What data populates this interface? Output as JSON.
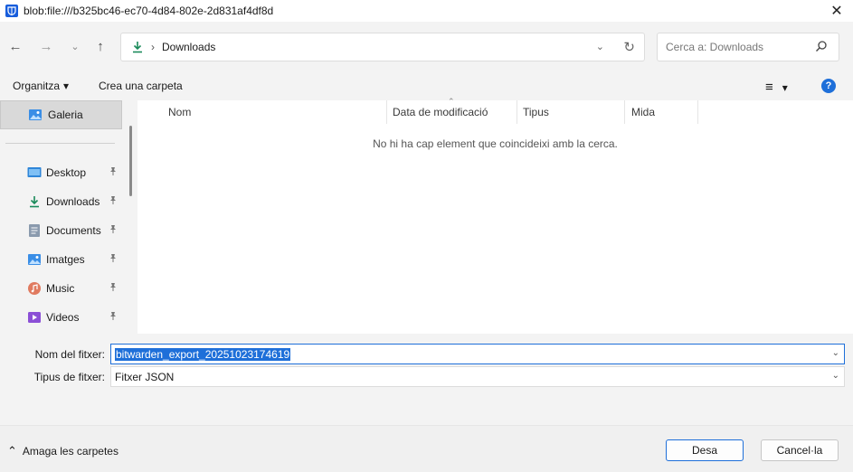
{
  "window": {
    "title": "blob:file:///b325bc46-ec70-4d84-802e-2d831af4df8d",
    "close_glyph": "✕"
  },
  "nav": {
    "back_glyph": "←",
    "forward_glyph": "→",
    "recent_glyph": "⌄",
    "up_glyph": "↑",
    "address_path": "Downloads",
    "address_chevron": "›",
    "address_dropdown_glyph": "⌄",
    "refresh_glyph": "↻",
    "search_placeholder": "Cerca a: Downloads"
  },
  "toolbar": {
    "organize_label": "Organitza",
    "organize_caret": "▾",
    "new_folder_label": "Crea una carpeta",
    "view_glyph": "≡",
    "view_caret": "▾",
    "help_glyph": "?"
  },
  "sidebar": {
    "gallery_label": "Galeria",
    "items": [
      {
        "label": "Desktop",
        "icon": "desktop-icon"
      },
      {
        "label": "Downloads",
        "icon": "downloads-icon"
      },
      {
        "label": "Documents",
        "icon": "documents-icon"
      },
      {
        "label": "Imatges",
        "icon": "pictures-icon"
      },
      {
        "label": "Music",
        "icon": "music-icon"
      },
      {
        "label": "Videos",
        "icon": "videos-icon"
      }
    ],
    "pin_glyph": "📌"
  },
  "files": {
    "columns": [
      "Nom",
      "Data de modificació",
      "Tipus",
      "Mida"
    ],
    "sort_caret": "⌃",
    "empty_message": "No hi ha cap element que coincideixi amb la cerca."
  },
  "form": {
    "filename_label": "Nom del fitxer:",
    "filename_value": "bitwarden_export_20251023174619",
    "filetype_label": "Tipus de fitxer:",
    "filetype_value": "Fitxer JSON",
    "dropdown_glyph": "⌄"
  },
  "footer": {
    "hide_folders_label": "Amaga les carpetes",
    "hide_caret": "⌃",
    "save_label": "Desa",
    "cancel_label": "Cancel·la"
  },
  "colors": {
    "accent": "#1e6fd9",
    "brand": "#175ddc"
  }
}
